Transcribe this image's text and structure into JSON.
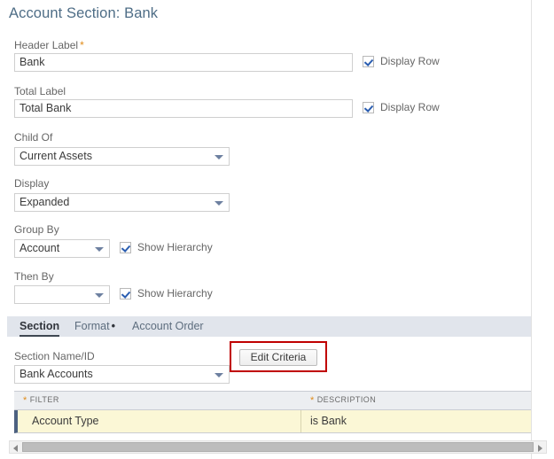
{
  "page": {
    "title": "Account Section: Bank"
  },
  "form": {
    "header_label": {
      "label": "Header Label",
      "required_marker": "*",
      "value": "Bank",
      "checkbox_label": "Display Row",
      "checked": true
    },
    "total_label": {
      "label": "Total Label",
      "value": "Total Bank",
      "checkbox_label": "Display Row",
      "checked": true
    },
    "child_of": {
      "label": "Child Of",
      "value": "Current Assets"
    },
    "display": {
      "label": "Display",
      "value": "Expanded"
    },
    "group_by": {
      "label": "Group By",
      "value": "Account",
      "checkbox_label": "Show Hierarchy",
      "checked": true
    },
    "then_by": {
      "label": "Then By",
      "value": "",
      "checkbox_label": "Show Hierarchy",
      "checked": true
    }
  },
  "tabs": [
    {
      "label": "Section",
      "active": true,
      "marker": ""
    },
    {
      "label": "Format",
      "active": false,
      "marker": "•"
    },
    {
      "label": "Account Order",
      "active": false,
      "marker": ""
    }
  ],
  "section_panel": {
    "name_id_label": "Section Name/ID",
    "name_id_value": "Bank Accounts",
    "edit_criteria_button": "Edit Criteria",
    "highlight_color": "#c00000"
  },
  "grid": {
    "columns": [
      {
        "label": "FILTER",
        "required_marker": "*"
      },
      {
        "label": "DESCRIPTION",
        "required_marker": "*"
      }
    ],
    "rows": [
      {
        "filter": "Account Type",
        "description": "is Bank"
      }
    ]
  },
  "scrollbar": {
    "left_arrow": "◂",
    "right_arrow": "▸"
  },
  "colors": {
    "title": "#4e6d86",
    "required": "#e08b19",
    "tabstrip_bg": "#e1e5ec",
    "row_highlight": "#fbf7d6",
    "row_marker": "#4c6180",
    "checkmark": "#2a5db0"
  }
}
